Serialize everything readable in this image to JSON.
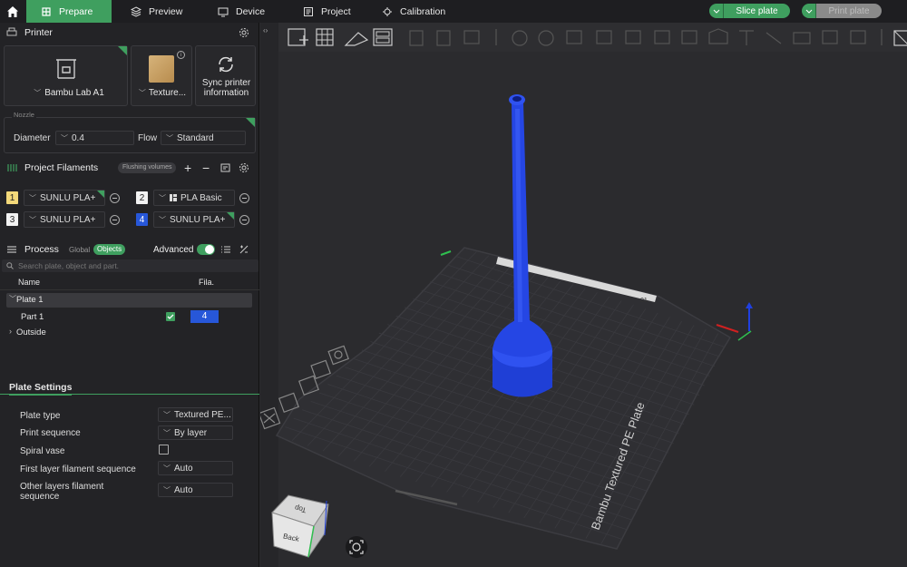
{
  "nav": {
    "tabs": [
      {
        "label": "Prepare"
      },
      {
        "label": "Preview"
      },
      {
        "label": "Device"
      },
      {
        "label": "Project"
      },
      {
        "label": "Calibration"
      }
    ],
    "slice_label": "Slice plate",
    "print_label": "Print plate"
  },
  "printer": {
    "section_title": "Printer",
    "model": "Bambu Lab A1",
    "plate": "Texture...",
    "sync_line1": "Sync printer",
    "sync_line2": "information",
    "nozzle_label": "Nozzle",
    "diameter_label": "Diameter",
    "diameter_value": "0.4",
    "flow_label": "Flow",
    "flow_value": "Standard"
  },
  "filaments": {
    "section_title": "Project Filaments",
    "flushing_label": "Flushing volumes",
    "items": [
      {
        "num": "1",
        "name": "SUNLU PLA+",
        "color": "#f3d97a",
        "text_color": "#222"
      },
      {
        "num": "2",
        "name": "PLA Basic",
        "color": "#f2f2f2",
        "text_color": "#222"
      },
      {
        "num": "3",
        "name": "SUNLU PLA+",
        "color": "#f2f2f2",
        "text_color": "#222"
      },
      {
        "num": "4",
        "name": "SUNLU PLA+",
        "color": "#2757d9",
        "text_color": "#ffffff"
      }
    ]
  },
  "process": {
    "section_title": "Process",
    "global_label": "Global",
    "objects_label": "Objects",
    "advanced_label": "Advanced",
    "search_placeholder": "Search plate, object and part.",
    "col_name": "Name",
    "col_fila": "Fila.",
    "plate_row": "Plate 1",
    "part_row": "Part 1",
    "part_fila": "4",
    "outside_row": "Outside"
  },
  "plate_settings": {
    "title": "Plate Settings",
    "rows": [
      {
        "label": "Plate type",
        "value": "Textured PE..."
      },
      {
        "label": "Print sequence",
        "value": "By layer"
      },
      {
        "label": "Spiral vase",
        "value": ""
      },
      {
        "label": "First layer filament sequence",
        "value": "Auto"
      },
      {
        "label": "Other layers filament",
        "label2": "sequence",
        "value": "Auto"
      }
    ]
  },
  "viewport": {
    "bed_label": "Bambu Textured PE Plate",
    "cube_top": "Top",
    "cube_back": "Back",
    "plate_number": "01"
  },
  "colors": {
    "accent": "#3f9f5f",
    "model_blue": "#1f3fd6",
    "bed": "#2e2e32"
  }
}
